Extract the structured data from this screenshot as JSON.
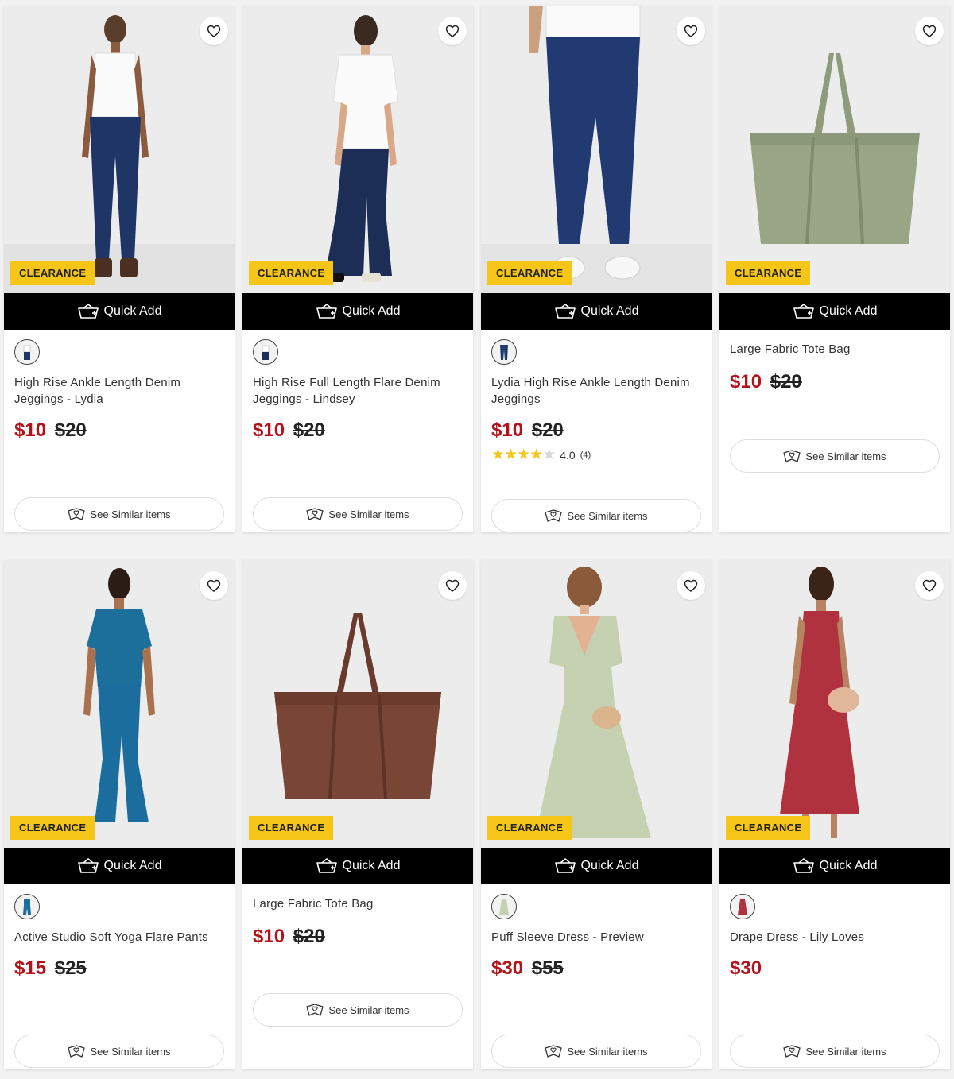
{
  "colors": {
    "sale": "#b3121a",
    "badge": "#f5c518",
    "quick_add_bg": "#000000"
  },
  "icons": {
    "wishlist": "heart-icon",
    "quick_add": "basket-icon",
    "similar": "hanger-hearts-icon"
  },
  "products": [
    {
      "badge": "CLEARANCE",
      "quick_add": "Quick Add",
      "title": "High Rise Ankle Length Denim Jeggings - Lydia",
      "price": "$10",
      "was": "$20",
      "similar": "See Similar items"
    },
    {
      "badge": "CLEARANCE",
      "quick_add": "Quick Add",
      "title": "High Rise Full Length Flare Denim Jeggings - Lindsey",
      "price": "$10",
      "was": "$20",
      "similar": "See Similar items"
    },
    {
      "badge": "CLEARANCE",
      "quick_add": "Quick Add",
      "title": "Lydia High Rise Ankle Length Denim Jeggings",
      "price": "$10",
      "was": "$20",
      "rating": "4.0",
      "rating_count": "(4)",
      "rating_stars": 4,
      "similar": "See Similar items"
    },
    {
      "badge": "CLEARANCE",
      "quick_add": "Quick Add",
      "title": "Large Fabric Tote Bag",
      "price": "$10",
      "was": "$20",
      "similar": "See Similar items"
    },
    {
      "badge": "CLEARANCE",
      "quick_add": "Quick Add",
      "title": "Active Studio Soft Yoga Flare Pants",
      "price": "$15",
      "was": "$25",
      "similar": "See Similar items"
    },
    {
      "badge": "CLEARANCE",
      "quick_add": "Quick Add",
      "title": "Large Fabric Tote Bag",
      "price": "$10",
      "was": "$20",
      "similar": "See Similar items"
    },
    {
      "badge": "CLEARANCE",
      "quick_add": "Quick Add",
      "title": "Puff Sleeve Dress - Preview",
      "price": "$30",
      "was": "$55",
      "similar": "See Similar items"
    },
    {
      "badge": "CLEARANCE",
      "quick_add": "Quick Add",
      "title": "Drape Dress - Lily Loves",
      "price": "$30",
      "similar": "See Similar items"
    }
  ]
}
